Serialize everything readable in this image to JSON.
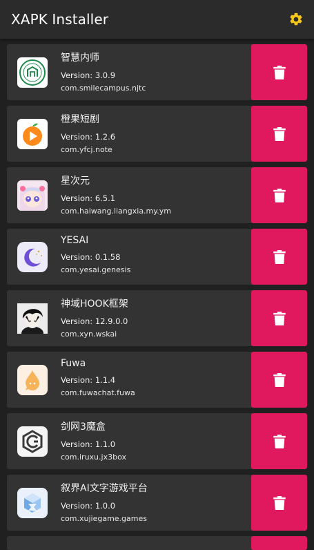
{
  "appbar": {
    "title": "XAPK Installer",
    "settings_icon": "gear-icon",
    "accent": "#f5c518"
  },
  "colors": {
    "delete_button": "#e0195f",
    "card": "#333333",
    "background": "#202020"
  },
  "apps": [
    {
      "name": "智慧内师",
      "version": "Version: 3.0.9",
      "package": "com.smilecampus.njtc",
      "icon": "school-seal-icon"
    },
    {
      "name": "橙果短剧",
      "version": "Version: 1.2.6",
      "package": "com.yfcj.note",
      "icon": "orange-play-icon"
    },
    {
      "name": "星次元",
      "version": "Version: 6.5.1",
      "package": "com.haiwang.liangxia.my.ym",
      "icon": "anime-girl-icon"
    },
    {
      "name": "YESAI",
      "version": "Version: 0.1.58",
      "package": "com.yesai.genesis",
      "icon": "moon-stars-icon"
    },
    {
      "name": "神域HOOK框架",
      "version": "Version: 12.9.0.0",
      "package": "com.xyn.wskai",
      "icon": "anime-boy-icon"
    },
    {
      "name": "Fuwa",
      "version": "Version: 1.1.4",
      "package": "com.fuwachat.fuwa",
      "icon": "droplet-chat-icon"
    },
    {
      "name": "剑网3魔盒",
      "version": "Version: 1.1.0",
      "package": "com.iruxu.jx3box",
      "icon": "hex-emblem-icon"
    },
    {
      "name": "叙界AI文字游戏平台",
      "version": "Version: 1.0.0",
      "package": "com.xujiegame.games",
      "icon": "crystal-cube-icon"
    }
  ]
}
